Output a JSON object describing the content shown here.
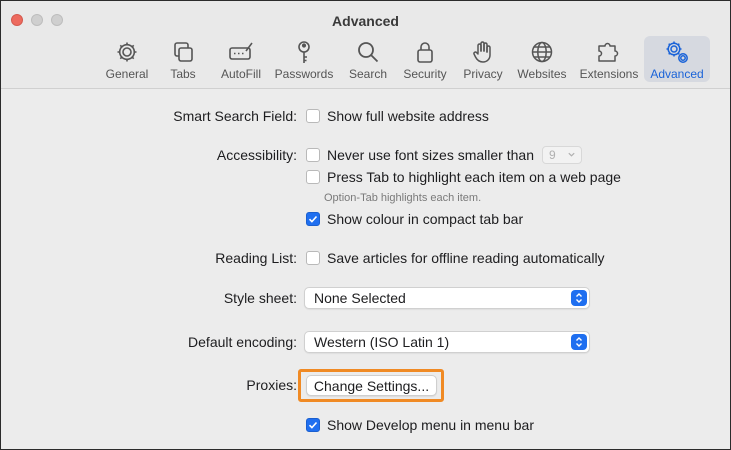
{
  "window": {
    "title": "Advanced"
  },
  "tabs": [
    {
      "label": "General",
      "icon": "gear-icon"
    },
    {
      "label": "Tabs",
      "icon": "tabs-icon"
    },
    {
      "label": "AutoFill",
      "icon": "autofill-icon"
    },
    {
      "label": "Passwords",
      "icon": "key-icon"
    },
    {
      "label": "Search",
      "icon": "search-icon"
    },
    {
      "label": "Security",
      "icon": "lock-icon"
    },
    {
      "label": "Privacy",
      "icon": "hand-icon"
    },
    {
      "label": "Websites",
      "icon": "globe-icon"
    },
    {
      "label": "Extensions",
      "icon": "puzzle-icon"
    },
    {
      "label": "Advanced",
      "icon": "gears-icon",
      "active": true
    }
  ],
  "settings": {
    "smart_search": {
      "label": "Smart Search Field:",
      "option": "Show full website address",
      "checked": false
    },
    "accessibility": {
      "label": "Accessibility:",
      "font_size_option": "Never use font sizes smaller than",
      "font_size_value": "9",
      "font_size_checked": false,
      "tab_option": "Press Tab to highlight each item on a web page",
      "tab_checked": false,
      "tab_hint": "Option-Tab highlights each item.",
      "colour_option": "Show colour in compact tab bar",
      "colour_checked": true
    },
    "reading_list": {
      "label": "Reading List:",
      "option": "Save articles for offline reading automatically",
      "checked": false
    },
    "style_sheet": {
      "label": "Style sheet:",
      "value": "None Selected"
    },
    "default_encoding": {
      "label": "Default encoding:",
      "value": "Western (ISO Latin 1)"
    },
    "proxies": {
      "label": "Proxies:",
      "button": "Change Settings..."
    },
    "develop_menu": {
      "option": "Show Develop menu in menu bar",
      "checked": true
    }
  },
  "colors": {
    "accent": "#1f6ff0",
    "highlight": "#f08a24",
    "close": "#ed6a5e"
  }
}
